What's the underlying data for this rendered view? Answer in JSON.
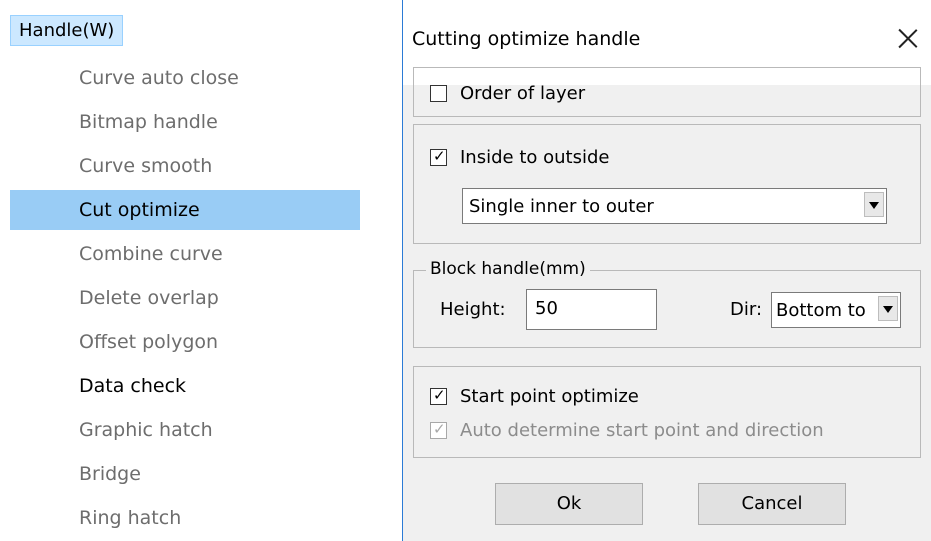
{
  "menu": {
    "title": "Handle(W)",
    "items": [
      {
        "label": "Curve auto close",
        "enabled": false
      },
      {
        "label": "Bitmap handle",
        "enabled": false
      },
      {
        "label": "Curve smooth",
        "enabled": false
      },
      {
        "label": "Cut optimize",
        "enabled": true,
        "selected": true
      },
      {
        "label": "Combine curve",
        "enabled": false
      },
      {
        "label": "Delete overlap",
        "enabled": false
      },
      {
        "label": "Offset polygon",
        "enabled": false
      },
      {
        "label": "Data check",
        "enabled": true
      },
      {
        "label": "Graphic hatch",
        "enabled": false
      },
      {
        "label": "Bridge",
        "enabled": false
      },
      {
        "label": "Ring hatch",
        "enabled": false
      }
    ]
  },
  "dialog": {
    "title": "Cutting optimize handle",
    "order_of_layer": {
      "label": "Order of layer",
      "checked": false
    },
    "inside_to_outside": {
      "label": "Inside to outside",
      "checked": true,
      "mode_value": "Single inner to outer"
    },
    "block_handle": {
      "legend": "Block handle(mm)",
      "height_label": "Height:",
      "height_value": "50",
      "dir_label": "Dir:",
      "dir_value": "Bottom to"
    },
    "start_point_optimize": {
      "label": "Start point optimize",
      "checked": true
    },
    "auto_determine": {
      "label": "Auto determine start point and direction",
      "checked": true,
      "disabled": true
    },
    "ok_label": "Ok",
    "cancel_label": "Cancel"
  },
  "colors": {
    "menu_selected": "#99ccf5",
    "menu_title_highlight": "#cce8ff",
    "dialog_bg": "#f0f0f0",
    "window_border": "#2b7bd6"
  }
}
